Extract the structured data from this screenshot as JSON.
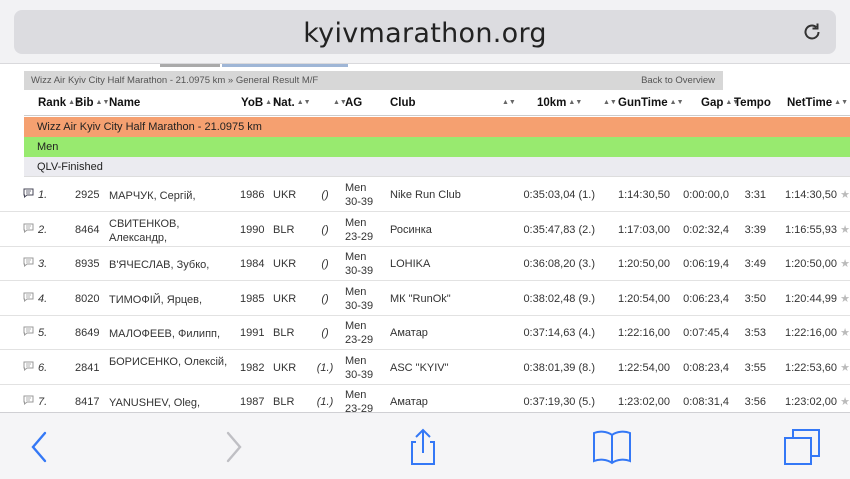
{
  "browser": {
    "url": "kyivmarathon.org"
  },
  "page": {
    "breadcrumb": "Wizz Air Kyiv City Half Marathon - 21.0975 km » General Result M/F",
    "back_link": "Back to Overview",
    "columns": {
      "rank": "Rank",
      "bib": "Bib",
      "name": "Name",
      "yob": "YoB",
      "nat": "Nat.",
      "ag": "AG",
      "club": "Club",
      "k10": "10km",
      "guntime": "GunTime",
      "gap": "Gap",
      "tempo": "Tempo",
      "nettime": "NetTime"
    },
    "race_band": "Wizz Air Kyiv City Half Marathon - 21.0975 km",
    "gender_band": "Men",
    "status_band": "QLV-Finished",
    "rows": [
      {
        "rank": "1.",
        "bib": "2925",
        "name": "МАРЧУК, Сергій,",
        "yob": "1986",
        "nat": "UKR",
        "paren": "()",
        "ag1": "Men",
        "ag2": "30-39",
        "club": "Nike Run Club",
        "k10": "0:35:03,04 (1.)",
        "gun": "1:14:30,50",
        "gap": "0:00:00,0",
        "tempo": "3:31",
        "net": "1:14:30,50"
      },
      {
        "rank": "2.",
        "bib": "8464",
        "name": "СВИТЕНКОВ, Александр,",
        "yob": "1990",
        "nat": "BLR",
        "paren": "()",
        "ag1": "Men",
        "ag2": "23-29",
        "club": "Росинка",
        "k10": "0:35:47,83 (2.)",
        "gun": "1:17:03,00",
        "gap": "0:02:32,4",
        "tempo": "3:39",
        "net": "1:16:55,93"
      },
      {
        "rank": "3.",
        "bib": "8935",
        "name": "В'ЯЧЕСЛАВ, Зубко,",
        "yob": "1984",
        "nat": "UKR",
        "paren": "()",
        "ag1": "Men",
        "ag2": "30-39",
        "club": "LOHIKA",
        "k10": "0:36:08,20 (3.)",
        "gun": "1:20:50,00",
        "gap": "0:06:19,4",
        "tempo": "3:49",
        "net": "1:20:50,00"
      },
      {
        "rank": "4.",
        "bib": "8020",
        "name": "ТИМОФІЙ, Ярцев,",
        "yob": "1985",
        "nat": "UKR",
        "paren": "()",
        "ag1": "Men",
        "ag2": "30-39",
        "club": "МК \"RunOk\"",
        "k10": "0:38:02,48 (9.)",
        "gun": "1:20:54,00",
        "gap": "0:06:23,4",
        "tempo": "3:50",
        "net": "1:20:44,99"
      },
      {
        "rank": "5.",
        "bib": "8649",
        "name": "МАЛОФЕЕВ, Филипп,",
        "yob": "1991",
        "nat": "BLR",
        "paren": "()",
        "ag1": "Men",
        "ag2": "23-29",
        "club": "Аматар",
        "k10": "0:37:14,63 (4.)",
        "gun": "1:22:16,00",
        "gap": "0:07:45,4",
        "tempo": "3:53",
        "net": "1:22:16,00"
      },
      {
        "rank": "6.",
        "bib": "2841",
        "name": "БОРИСЕНКО, Олексій,",
        "yob": "1982",
        "nat": "UKR",
        "paren": "(1.)",
        "ag1": "Men",
        "ag2": "30-39",
        "club": "ASC \"KYIV\"",
        "k10": "0:38:01,39 (8.)",
        "gun": "1:22:54,00",
        "gap": "0:08:23,4",
        "tempo": "3:55",
        "net": "1:22:53,60"
      },
      {
        "rank": "7.",
        "bib": "8417",
        "name": "YANUSHEV, Oleg,",
        "yob": "1987",
        "nat": "BLR",
        "paren": "(1.)",
        "ag1": "Men",
        "ag2": "23-29",
        "club": "Аматар",
        "k10": "0:37:19,30 (5.)",
        "gun": "1:23:02,00",
        "gap": "0:08:31,4",
        "tempo": "3:56",
        "net": "1:23:02,00"
      }
    ]
  },
  "toolbar": {
    "back_icon": "chevron-left-icon",
    "forward_icon": "chevron-right-icon",
    "share_icon": "share-icon",
    "bookmarks_icon": "book-icon",
    "tabs_icon": "tabs-icon"
  },
  "colors": {
    "race_band": "#f5a070",
    "gender_band": "#98ea6f",
    "status_band": "#ebebf0",
    "breadcrumb_bg": "#d7d7d7"
  }
}
